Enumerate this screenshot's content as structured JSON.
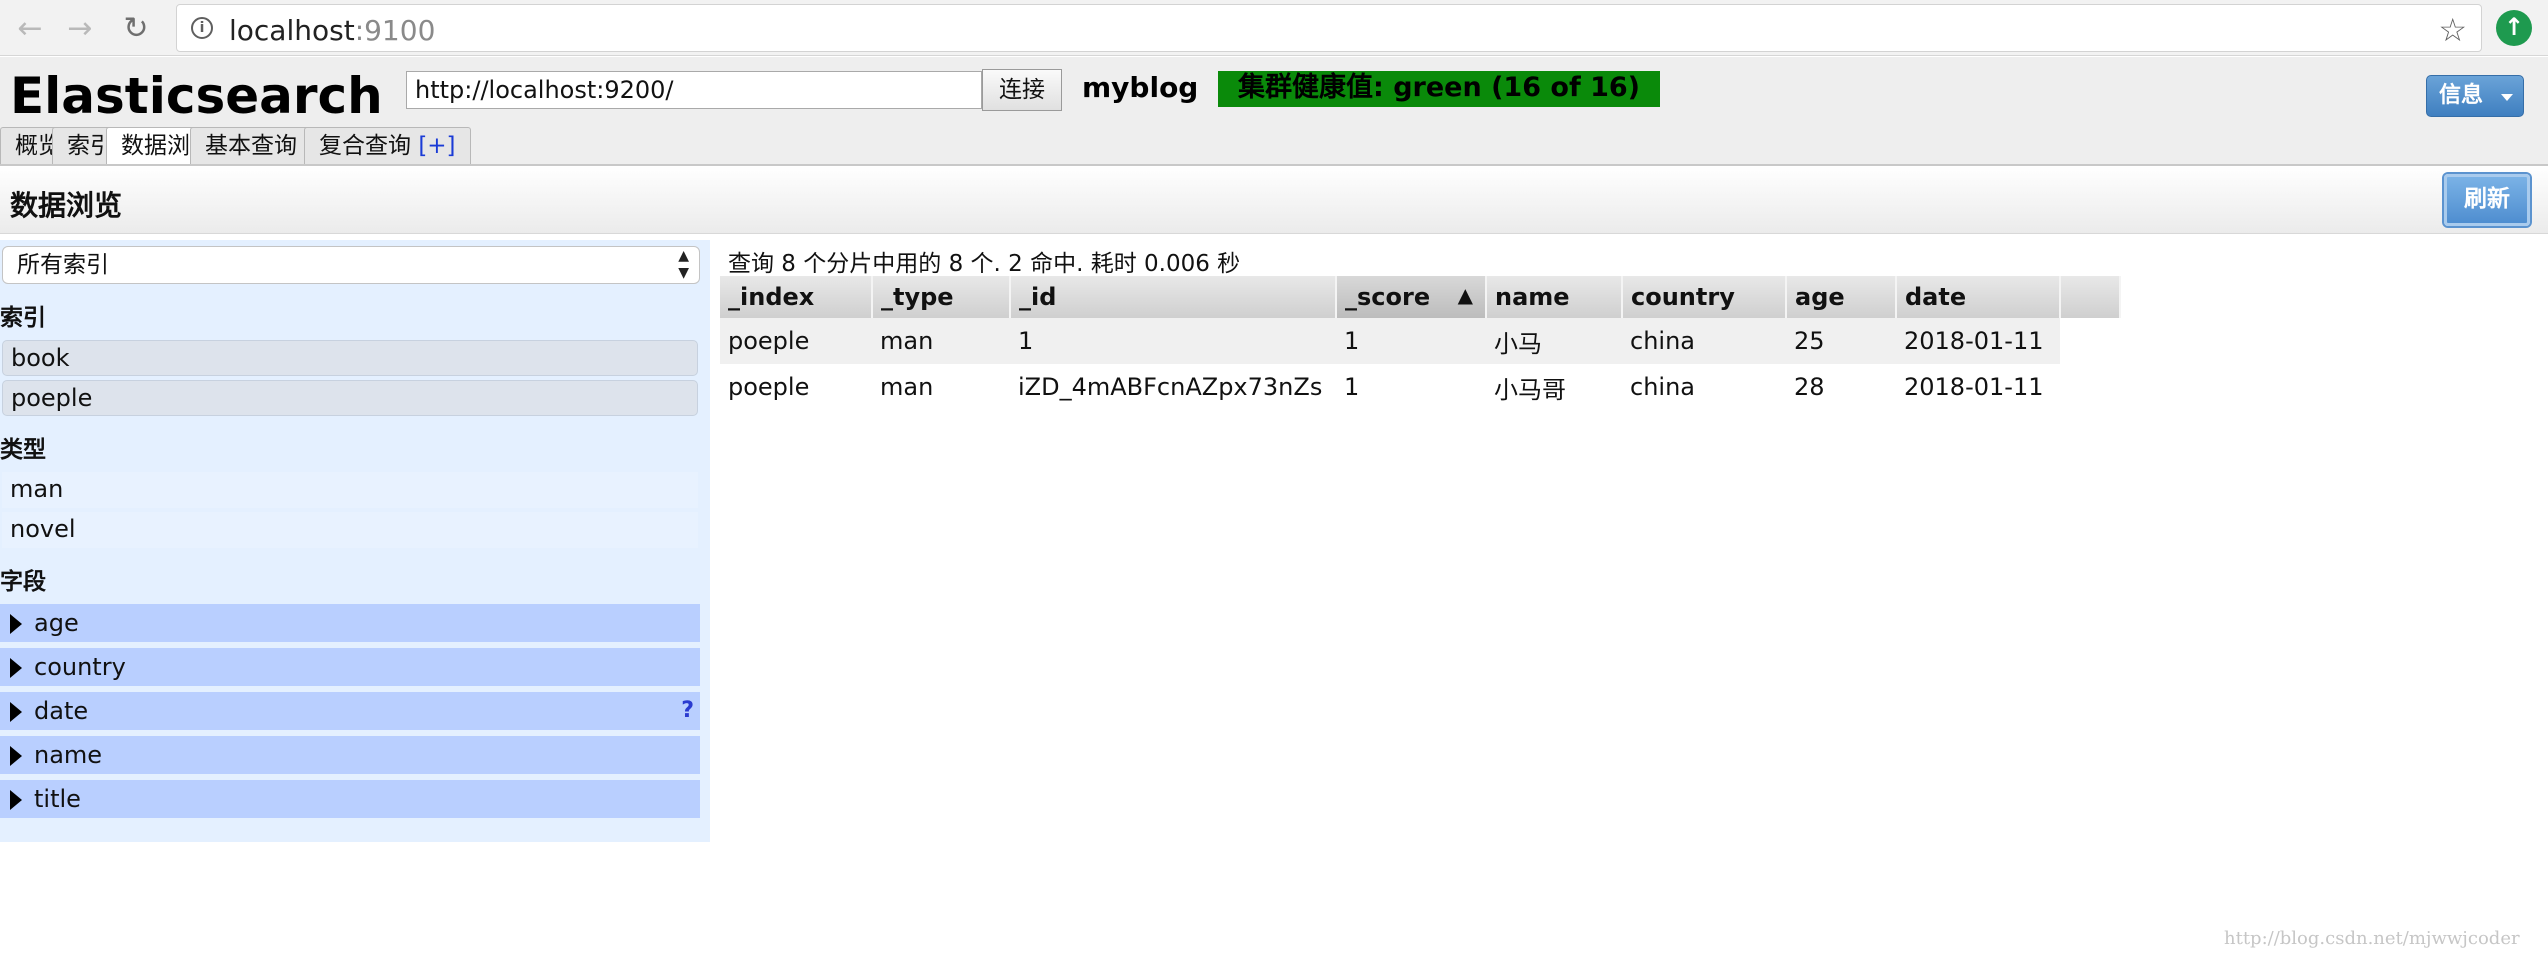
{
  "browser": {
    "url_host": "localhost",
    "url_port": ":9100",
    "back_icon": "arrow-left-icon",
    "forward_icon": "arrow-right-icon",
    "reload_icon": "reload-icon",
    "star_icon": "star-icon",
    "extension_icon": "update-arrow-icon"
  },
  "header": {
    "logo": "Elasticsearch",
    "server_url": "http://localhost:9200/",
    "connect_label": "连接",
    "cluster_name": "myblog",
    "health": "集群健康值: green (16 of 16)",
    "health_color": "#0a8a0a",
    "info_label": "信息"
  },
  "tabs": [
    {
      "label": "概览"
    },
    {
      "label": "索引"
    },
    {
      "label": "数据浏览"
    },
    {
      "label": "基本查询",
      "plus": "[+]"
    },
    {
      "label": "复合查询",
      "plus": "[+]"
    }
  ],
  "section": {
    "title": "数据浏览",
    "refresh_label": "刷新"
  },
  "sidebar": {
    "index_select_value": "所有索引",
    "indices_heading": "索引",
    "indices": [
      "book",
      "poeple"
    ],
    "types_heading": "类型",
    "types": [
      "man",
      "novel"
    ],
    "fields_heading": "字段",
    "fields": [
      "age",
      "country",
      "date",
      "name",
      "title"
    ],
    "date_help": "?"
  },
  "results": {
    "summary": "查询 8 个分片中用的 8 个. 2 命中. 耗时 0.006 秒",
    "columns": [
      "_index",
      "_type",
      "_id",
      "_score",
      "name",
      "country",
      "age",
      "date"
    ],
    "sort_indicator": "▲",
    "rows": [
      [
        "poeple",
        "man",
        "1",
        "1",
        "小马",
        "china",
        "25",
        "2018-01-11"
      ],
      [
        "poeple",
        "man",
        "iZD_4mABFcnAZpx73nZs",
        "1",
        "小马哥",
        "china",
        "28",
        "2018-01-11"
      ]
    ]
  },
  "watermark": "http://blog.csdn.net/mjwwjcoder"
}
